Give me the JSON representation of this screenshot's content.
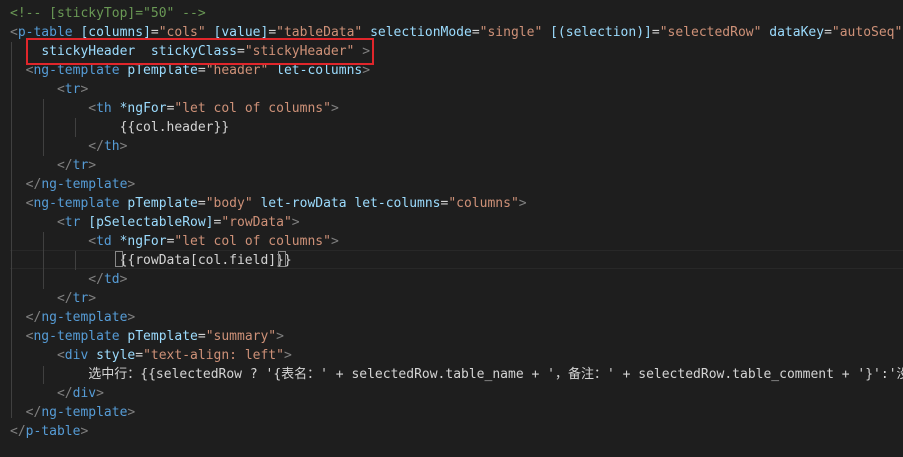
{
  "colors": {
    "background": "#1e1e1e",
    "tag_punctuation": "#808080",
    "tag_name": "#569cd6",
    "attribute": "#9cdcfe",
    "string": "#ce9178",
    "comment": "#6a9955",
    "highlight_border": "#e0262b"
  },
  "code": {
    "lines": [
      {
        "tokens": [
          {
            "c": "c",
            "v": "<!-- [stickyTop]=\"50\" -->"
          }
        ]
      },
      {
        "tokens": [
          {
            "c": "t",
            "v": "<"
          },
          {
            "c": "n",
            "v": "p-table"
          },
          {
            "c": "p",
            "v": " "
          },
          {
            "c": "a",
            "v": "[columns]"
          },
          {
            "c": "p",
            "v": "="
          },
          {
            "c": "s",
            "v": "\"cols\""
          },
          {
            "c": "p",
            "v": " "
          },
          {
            "c": "a",
            "v": "[value]"
          },
          {
            "c": "p",
            "v": "="
          },
          {
            "c": "s",
            "v": "\"tableData\""
          },
          {
            "c": "p",
            "v": " "
          },
          {
            "c": "a",
            "v": "selectionMode"
          },
          {
            "c": "p",
            "v": "="
          },
          {
            "c": "s",
            "v": "\"single\""
          },
          {
            "c": "p",
            "v": " "
          },
          {
            "c": "a",
            "v": "[(selection)]"
          },
          {
            "c": "p",
            "v": "="
          },
          {
            "c": "s",
            "v": "\"selectedRow\""
          },
          {
            "c": "p",
            "v": " "
          },
          {
            "c": "a",
            "v": "dataKey"
          },
          {
            "c": "p",
            "v": "="
          },
          {
            "c": "s",
            "v": "\"autoSeq\""
          }
        ]
      },
      {
        "tokens": [
          {
            "c": "p",
            "v": "    "
          },
          {
            "c": "a",
            "v": "stickyHeader"
          },
          {
            "c": "p",
            "v": "  "
          },
          {
            "c": "a",
            "v": "stickyClass"
          },
          {
            "c": "p",
            "v": "="
          },
          {
            "c": "s",
            "v": "\"stickyHeader\""
          },
          {
            "c": "p",
            "v": " "
          },
          {
            "c": "t",
            "v": ">"
          }
        ]
      },
      {
        "tokens": [
          {
            "c": "p",
            "v": "  "
          },
          {
            "c": "t",
            "v": "<"
          },
          {
            "c": "n",
            "v": "ng-template"
          },
          {
            "c": "p",
            "v": " "
          },
          {
            "c": "a",
            "v": "pTemplate"
          },
          {
            "c": "p",
            "v": "="
          },
          {
            "c": "s",
            "v": "\"header\""
          },
          {
            "c": "p",
            "v": " "
          },
          {
            "c": "a",
            "v": "let-columns"
          },
          {
            "c": "t",
            "v": ">"
          }
        ]
      },
      {
        "tokens": [
          {
            "c": "p",
            "v": "      "
          },
          {
            "c": "t",
            "v": "<"
          },
          {
            "c": "n",
            "v": "tr"
          },
          {
            "c": "t",
            "v": ">"
          }
        ]
      },
      {
        "tokens": [
          {
            "c": "p",
            "v": "          "
          },
          {
            "c": "t",
            "v": "<"
          },
          {
            "c": "n",
            "v": "th"
          },
          {
            "c": "p",
            "v": " "
          },
          {
            "c": "a",
            "v": "*ngFor"
          },
          {
            "c": "p",
            "v": "="
          },
          {
            "c": "s",
            "v": "\"let col of columns\""
          },
          {
            "c": "t",
            "v": ">"
          }
        ]
      },
      {
        "tokens": [
          {
            "c": "p",
            "v": "              {{col.header}}"
          }
        ]
      },
      {
        "tokens": [
          {
            "c": "p",
            "v": "          "
          },
          {
            "c": "t",
            "v": "</"
          },
          {
            "c": "n",
            "v": "th"
          },
          {
            "c": "t",
            "v": ">"
          }
        ]
      },
      {
        "tokens": [
          {
            "c": "p",
            "v": "      "
          },
          {
            "c": "t",
            "v": "</"
          },
          {
            "c": "n",
            "v": "tr"
          },
          {
            "c": "t",
            "v": ">"
          }
        ]
      },
      {
        "tokens": [
          {
            "c": "p",
            "v": "  "
          },
          {
            "c": "t",
            "v": "</"
          },
          {
            "c": "n",
            "v": "ng-template"
          },
          {
            "c": "t",
            "v": ">"
          }
        ]
      },
      {
        "tokens": [
          {
            "c": "p",
            "v": "  "
          },
          {
            "c": "t",
            "v": "<"
          },
          {
            "c": "n",
            "v": "ng-template"
          },
          {
            "c": "p",
            "v": " "
          },
          {
            "c": "a",
            "v": "pTemplate"
          },
          {
            "c": "p",
            "v": "="
          },
          {
            "c": "s",
            "v": "\"body\""
          },
          {
            "c": "p",
            "v": " "
          },
          {
            "c": "a",
            "v": "let-rowData"
          },
          {
            "c": "p",
            "v": " "
          },
          {
            "c": "a",
            "v": "let-columns"
          },
          {
            "c": "p",
            "v": "="
          },
          {
            "c": "s",
            "v": "\"columns\""
          },
          {
            "c": "t",
            "v": ">"
          }
        ]
      },
      {
        "tokens": [
          {
            "c": "p",
            "v": "      "
          },
          {
            "c": "t",
            "v": "<"
          },
          {
            "c": "n",
            "v": "tr"
          },
          {
            "c": "p",
            "v": " "
          },
          {
            "c": "a",
            "v": "[pSelectableRow]"
          },
          {
            "c": "p",
            "v": "="
          },
          {
            "c": "s",
            "v": "\"rowData\""
          },
          {
            "c": "t",
            "v": ">"
          }
        ]
      },
      {
        "tokens": [
          {
            "c": "p",
            "v": "          "
          },
          {
            "c": "t",
            "v": "<"
          },
          {
            "c": "n",
            "v": "td"
          },
          {
            "c": "p",
            "v": " "
          },
          {
            "c": "a",
            "v": "*ngFor"
          },
          {
            "c": "p",
            "v": "="
          },
          {
            "c": "s",
            "v": "\"let col of columns\""
          },
          {
            "c": "t",
            "v": ">"
          }
        ]
      },
      {
        "tokens": [
          {
            "c": "p",
            "v": "              {{rowData[col.field]}}"
          }
        ]
      },
      {
        "tokens": [
          {
            "c": "p",
            "v": "          "
          },
          {
            "c": "t",
            "v": "</"
          },
          {
            "c": "n",
            "v": "td"
          },
          {
            "c": "t",
            "v": ">"
          }
        ]
      },
      {
        "tokens": [
          {
            "c": "p",
            "v": "      "
          },
          {
            "c": "t",
            "v": "</"
          },
          {
            "c": "n",
            "v": "tr"
          },
          {
            "c": "t",
            "v": ">"
          }
        ]
      },
      {
        "tokens": [
          {
            "c": "p",
            "v": "  "
          },
          {
            "c": "t",
            "v": "</"
          },
          {
            "c": "n",
            "v": "ng-template"
          },
          {
            "c": "t",
            "v": ">"
          }
        ]
      },
      {
        "tokens": [
          {
            "c": "p",
            "v": "  "
          },
          {
            "c": "t",
            "v": "<"
          },
          {
            "c": "n",
            "v": "ng-template"
          },
          {
            "c": "p",
            "v": " "
          },
          {
            "c": "a",
            "v": "pTemplate"
          },
          {
            "c": "p",
            "v": "="
          },
          {
            "c": "s",
            "v": "\"summary\""
          },
          {
            "c": "t",
            "v": ">"
          }
        ]
      },
      {
        "tokens": [
          {
            "c": "p",
            "v": "      "
          },
          {
            "c": "t",
            "v": "<"
          },
          {
            "c": "n",
            "v": "div"
          },
          {
            "c": "p",
            "v": " "
          },
          {
            "c": "a",
            "v": "style"
          },
          {
            "c": "p",
            "v": "="
          },
          {
            "c": "s",
            "v": "\"text-align: left\""
          },
          {
            "c": "t",
            "v": ">"
          }
        ]
      },
      {
        "tokens": [
          {
            "c": "p",
            "v": "          选中行：{{selectedRow ? '{表名：' + selectedRow.table_name + '，备注：' + selectedRow.table_comment + '}':'没"
          }
        ]
      },
      {
        "tokens": [
          {
            "c": "p",
            "v": "      "
          },
          {
            "c": "t",
            "v": "</"
          },
          {
            "c": "n",
            "v": "div"
          },
          {
            "c": "t",
            "v": ">"
          }
        ]
      },
      {
        "tokens": [
          {
            "c": "p",
            "v": "  "
          },
          {
            "c": "t",
            "v": "</"
          },
          {
            "c": "n",
            "v": "ng-template"
          },
          {
            "c": "t",
            "v": ">"
          }
        ]
      },
      {
        "tokens": [
          {
            "c": "t",
            "v": "</"
          },
          {
            "c": "n",
            "v": "p-table"
          },
          {
            "c": "t",
            "v": ">"
          }
        ]
      }
    ]
  }
}
